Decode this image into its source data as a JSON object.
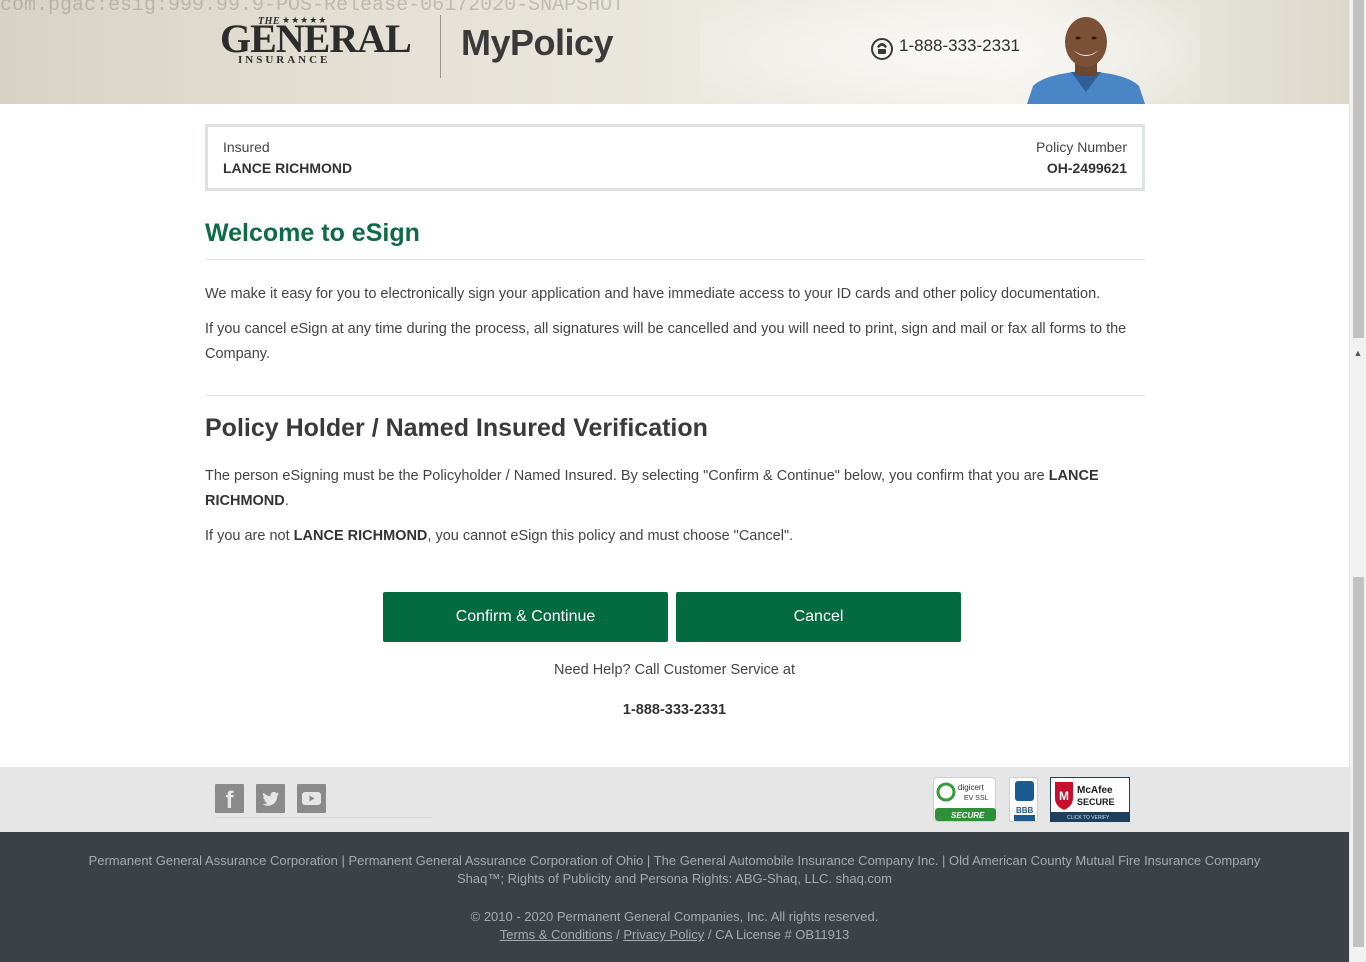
{
  "header": {
    "build_text": "com.pgac:esig:999.99.9-POS-Release-06172020-SNAPSHOT",
    "logo_the": "THE",
    "logo_stars": "★★★★★",
    "logo_general": "GENERAL",
    "logo_insurance": "INSURANCE",
    "app_title": "MyPolicy",
    "phone": "1-888-333-2331"
  },
  "policy_box": {
    "insured_label": "Insured",
    "insured_name": "LANCE RICHMOND",
    "policy_number_label": "Policy Number",
    "policy_number": "OH-2499621"
  },
  "welcome": {
    "title": "Welcome to eSign",
    "paragraph_1": "We make it easy for you to electronically sign your application and have immediate access to your ID cards and other policy documentation.",
    "paragraph_2": "If you cancel eSign at any time during the process, all signatures will be cancelled and you will need to print, sign and mail or fax all forms to the Company."
  },
  "verification": {
    "title": "Policy Holder / Named Insured Verification",
    "p3_prefix": "The person eSigning must be the Policyholder / Named Insured. By selecting \"Confirm & Continue\" below, you confirm that you are ",
    "p3_name": "LANCE RICHMOND",
    "p3_suffix": ".",
    "p4_prefix": "If you are not ",
    "p4_name": "LANCE RICHMOND",
    "p4_suffix": ", you cannot eSign this policy and must choose \"Cancel\"."
  },
  "actions": {
    "confirm_label": "Confirm & Continue",
    "cancel_label": "Cancel"
  },
  "help": {
    "text": "Need Help? Call Customer Service at",
    "phone": "1-888-333-2331"
  },
  "footer": {
    "social": [
      {
        "name": "facebook-icon",
        "glyph": "f"
      },
      {
        "name": "twitter-icon"
      },
      {
        "name": "youtube-icon"
      }
    ],
    "badges": {
      "digicert_line1": "digicert",
      "digicert_line2": "EV SSL",
      "digicert_secure": "SECURE",
      "bbb": "BBB",
      "mcafee_line1": "McAfee",
      "mcafee_line2": "SECURE",
      "mcafee_line3": "CLICK TO VERIFY"
    },
    "companies": "Permanent General Assurance Corporation | Permanent General Assurance Corporation of Ohio | The General Automobile Insurance Company Inc. | Old American County Mutual Fire Insurance Company",
    "publicity": "Shaq™; Rights of Publicity and Persona Rights: ABG-Shaq, LLC. shaq.com",
    "copyright": "© 2010 - 2020 Permanent General Companies, Inc. All rights reserved.",
    "terms_label": "Terms & Conditions",
    "separator": "/",
    "privacy_label": "Privacy Policy",
    "license": "/ CA License # OB11913"
  },
  "colors": {
    "brand_green": "#046a40",
    "title_green": "#0f6b46",
    "footer_dark": "#3c4148"
  }
}
